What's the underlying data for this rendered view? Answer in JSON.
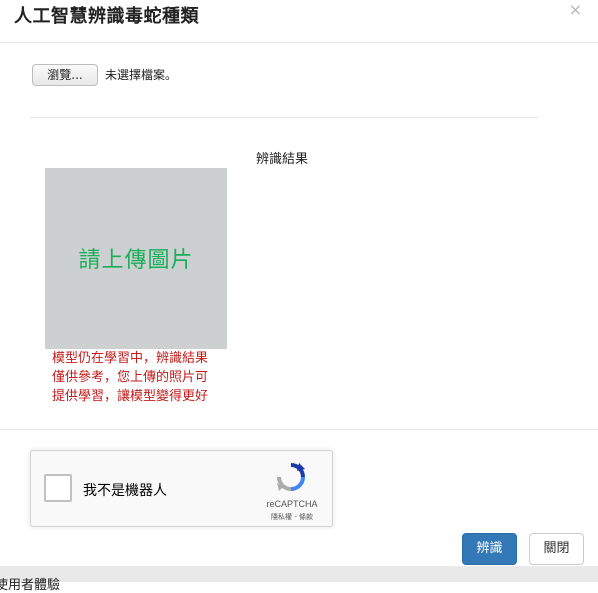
{
  "modal": {
    "title": "人工智慧辨識毒蛇種類",
    "close_glyph": "×"
  },
  "file_input": {
    "button_label": "瀏覽...",
    "status_text": "未選擇檔案。"
  },
  "result": {
    "heading": "辨識結果"
  },
  "preview": {
    "placeholder_text": "請上傳圖片",
    "background_color": "#cdd0d1",
    "text_color": "#1aad5b"
  },
  "notice": {
    "lines": [
      "模型仍在學習中，辨識結果",
      "僅供參考，您上傳的照片可",
      "提供學習，讓模型變得更好"
    ],
    "color": "#c21c1c"
  },
  "recaptcha": {
    "checkbox_label": "我不是機器人",
    "brand": "reCAPTCHA",
    "links": "隱私權 - 條款",
    "icon": "recaptcha-logo-icon"
  },
  "buttons": {
    "identify_label": "辨識",
    "close_label": "關閉",
    "primary_color": "#3379b8"
  },
  "footer": {
    "text": "使用者體驗"
  }
}
